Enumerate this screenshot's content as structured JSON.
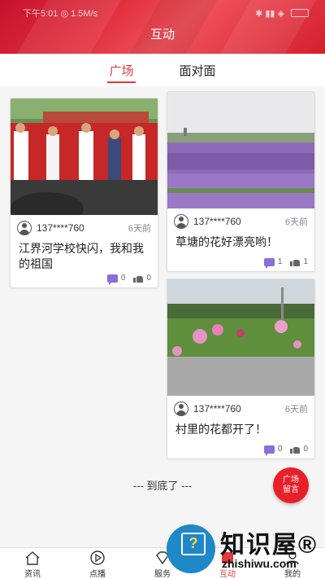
{
  "status_bar": {
    "left": "下午5:01  ◎  1.5M/s",
    "right": "✱ ▮▮ ◈"
  },
  "header": {
    "title": "互动"
  },
  "tabs": [
    {
      "label": "广场",
      "active": true
    },
    {
      "label": "面对面",
      "active": false
    }
  ],
  "posts": [
    {
      "user": "137****760",
      "time": "6天前",
      "text": "江界河学校快闪，我和我的祖国",
      "comments": "0",
      "likes": "0"
    },
    {
      "user": "137****760",
      "time": "6天前",
      "text": "草塘的花好漂亮哟！",
      "comments": "1",
      "likes": "1"
    },
    {
      "user": "137****760",
      "time": "6天前",
      "text": "村里的花都开了！",
      "comments": "0",
      "likes": "0"
    }
  ],
  "end_text": "--- 到底了 ---",
  "fab": {
    "line1": "广场",
    "line2": "留言"
  },
  "nav": [
    {
      "label": "资讯",
      "icon": "home-icon"
    },
    {
      "label": "点播",
      "icon": "play-icon"
    },
    {
      "label": "服务",
      "icon": "diamond-icon"
    },
    {
      "label": "互动",
      "icon": "interact-icon",
      "active": true
    },
    {
      "label": "我的",
      "icon": "user-icon"
    }
  ],
  "watermark": {
    "cn": "知识屋®",
    "en": "zhishiwu.com"
  },
  "colors": {
    "brand_red": "#e33a3a",
    "comment_purple": "#8a6fd8"
  }
}
